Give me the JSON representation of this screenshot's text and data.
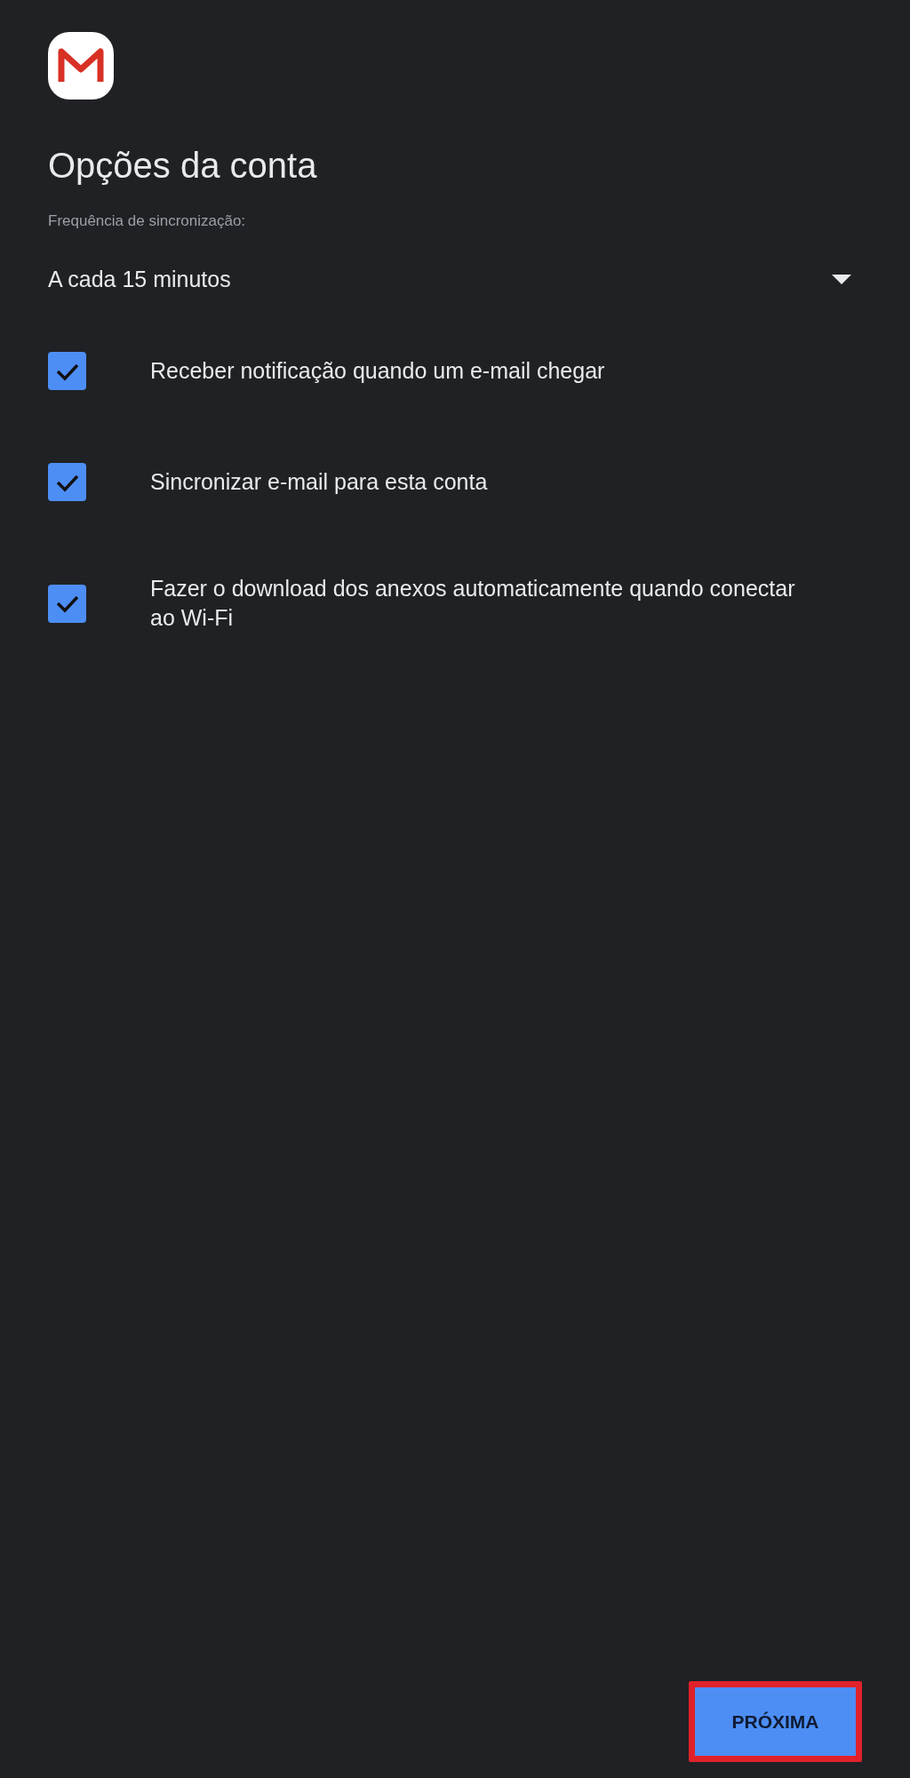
{
  "title": "Opções da conta",
  "sync_frequency": {
    "label": "Frequência de sincronização:",
    "value": "A cada 15 minutos"
  },
  "options": [
    {
      "label": "Receber notificação quando um e-mail chegar",
      "checked": true
    },
    {
      "label": "Sincronizar e-mail para esta conta",
      "checked": true
    },
    {
      "label": "Fazer o download dos anexos automaticamente quando conectar ao Wi-Fi",
      "checked": true
    }
  ],
  "next_button": {
    "label": "PRÓXIMA",
    "highlighted": true
  }
}
